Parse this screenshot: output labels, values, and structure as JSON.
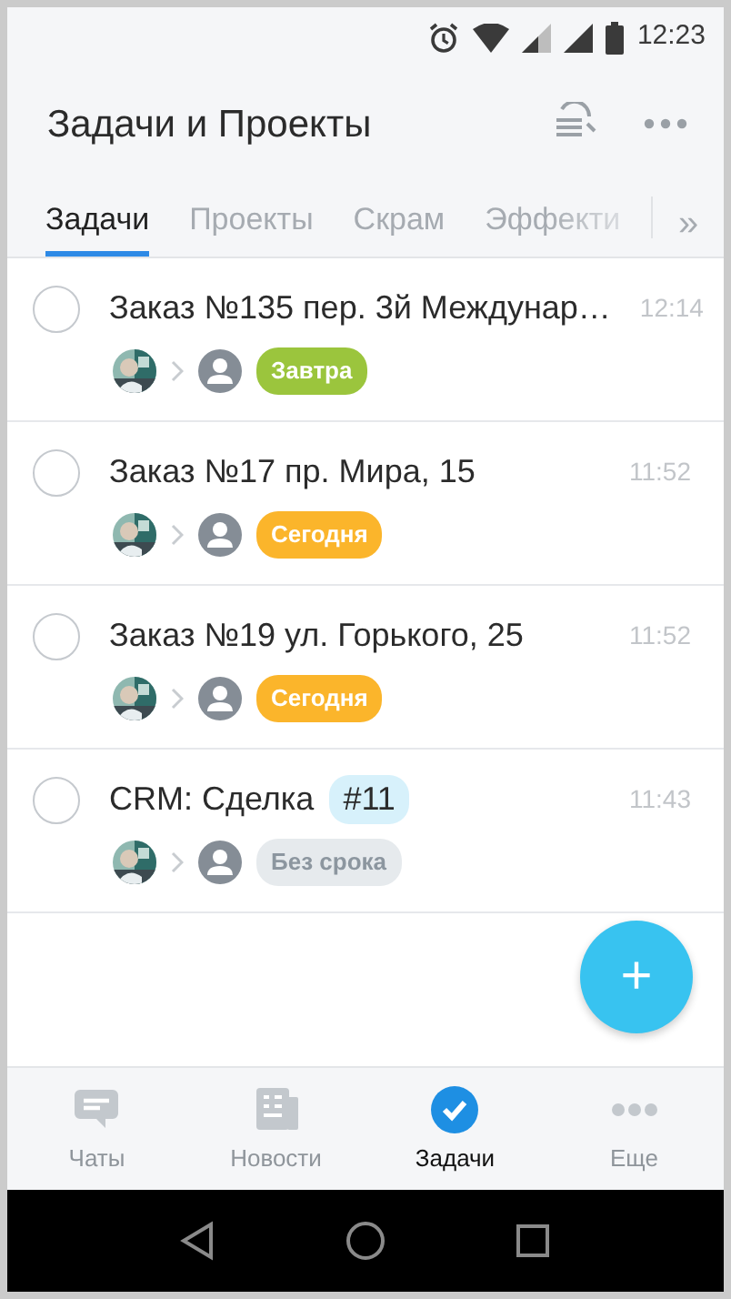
{
  "status_bar": {
    "time": "12:23"
  },
  "header": {
    "title": "Задачи и Проекты"
  },
  "tabs": [
    {
      "label": "Задачи",
      "selected": true
    },
    {
      "label": "Проекты",
      "selected": false
    },
    {
      "label": "Скрам",
      "selected": false
    },
    {
      "label": "Эффекти",
      "selected": false
    }
  ],
  "tabs_more": "»",
  "tasks": [
    {
      "title": "Заказ №135 пер. 3й Междунар…",
      "time": "12:14",
      "checked": false,
      "due": {
        "label": "Завтра",
        "kind": "tomorrow"
      }
    },
    {
      "title": "Заказ №17 пр. Мира, 15",
      "time": "11:52",
      "checked": false,
      "due": {
        "label": "Сегодня",
        "kind": "today"
      }
    },
    {
      "title": "Заказ №19 ул. Горького, 25",
      "time": "11:52",
      "checked": false,
      "due": {
        "label": "Сегодня",
        "kind": "today"
      }
    },
    {
      "title": "CRM: Сделка",
      "tag": "#11",
      "time": "11:43",
      "checked": false,
      "due": {
        "label": "Без срока",
        "kind": "none"
      }
    }
  ],
  "fab": "+",
  "bottom_nav": [
    {
      "label": "Чаты",
      "kind": "chat",
      "selected": false
    },
    {
      "label": "Новости",
      "kind": "news",
      "selected": false
    },
    {
      "label": "Задачи",
      "kind": "tasks",
      "selected": true
    },
    {
      "label": "Еще",
      "kind": "more",
      "selected": false
    }
  ]
}
